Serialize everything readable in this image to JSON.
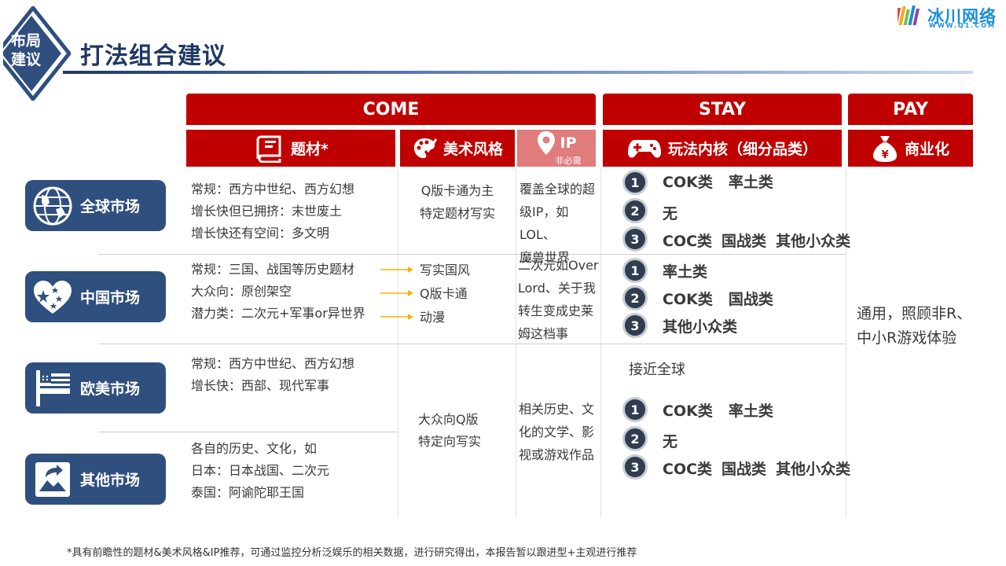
{
  "header": {
    "badge_line1": "布局",
    "badge_line2": "建议",
    "title": "打法组合建议",
    "logo_text": "冰川网络",
    "logo_url": "WWW.Q1.COM"
  },
  "bands": {
    "come": "COME",
    "stay": "STAY",
    "pay": "PAY"
  },
  "subheaders": {
    "topic": "题材*",
    "art": "美术风格",
    "ip": "IP",
    "ip_note": "非必需",
    "core": "玩法内核（细分品类）",
    "monetize": "商业化"
  },
  "markets": [
    {
      "name": "全球市场",
      "icon": "globe-icon"
    },
    {
      "name": "中国市场",
      "icon": "heart-stars-icon"
    },
    {
      "name": "欧美市场",
      "icon": "flag-icon"
    },
    {
      "name": "其他市场",
      "icon": "picture-icon"
    }
  ],
  "topic": {
    "global": [
      "常规：西方中世纪、西方幻想",
      "增长快但已拥挤：末世废土",
      "增长快还有空间：多文明"
    ],
    "china": [
      "常规：三国、战国等历史题材",
      "大众向：原创架空",
      "潜力类：二次元+军事or异世界"
    ],
    "west": [
      "常规：西方中世纪、西方幻想",
      "增长快：西部、现代军事"
    ],
    "other": [
      "各自的历史、文化，如",
      "日本：日本战国、二次元",
      "泰国：阿谕陀耶王国"
    ]
  },
  "art": {
    "global": [
      "Q版卡通为主",
      "特定题材写实"
    ],
    "china": [
      "写实国风",
      "Q版卡通",
      "动漫"
    ],
    "west_other": [
      "大众向Q版",
      "特定向写实"
    ]
  },
  "ip": {
    "global": [
      "覆盖全球的超",
      "级IP，如LOL、",
      "魔兽世界"
    ],
    "china": [
      "二次元如Over",
      "Lord、关于我",
      "转生变成史莱",
      "姆这档事"
    ],
    "west_other": [
      "相关历史、文",
      "化的文学、影",
      "视或游戏作品"
    ]
  },
  "stay": {
    "global": [
      {
        "n": "1",
        "items": [
          "COK类",
          "率土类"
        ]
      },
      {
        "n": "2",
        "items": [
          "无"
        ]
      },
      {
        "n": "3",
        "items": [
          "COC类",
          "国战类",
          "其他小众类"
        ]
      }
    ],
    "china": [
      {
        "n": "1",
        "items": [
          "率土类"
        ]
      },
      {
        "n": "2",
        "items": [
          "COK类",
          "国战类"
        ]
      },
      {
        "n": "3",
        "items": [
          "其他小众类"
        ]
      }
    ],
    "west_other_note": "接近全球",
    "west_other": [
      {
        "n": "1",
        "items": [
          "COK类",
          "率土类"
        ]
      },
      {
        "n": "2",
        "items": [
          "无"
        ]
      },
      {
        "n": "3",
        "items": [
          "COC类",
          "国战类",
          "其他小众类"
        ]
      }
    ]
  },
  "pay": {
    "line1": "通用，照顾非R、",
    "line2": "中小R游戏体验"
  },
  "footnote": "*具有前瞻性的题材&美术风格&IP推荐，可通过监控分析泛娱乐的相关数据，进行研究得出，本报告暂以跟进型+主观进行推荐",
  "colors": {
    "primary_red": "#c00000",
    "ip_pink": "#e07c7c",
    "navy": "#2f4f7f",
    "title_blue": "#1f3864",
    "logo_blue": "#1a8fd8"
  }
}
